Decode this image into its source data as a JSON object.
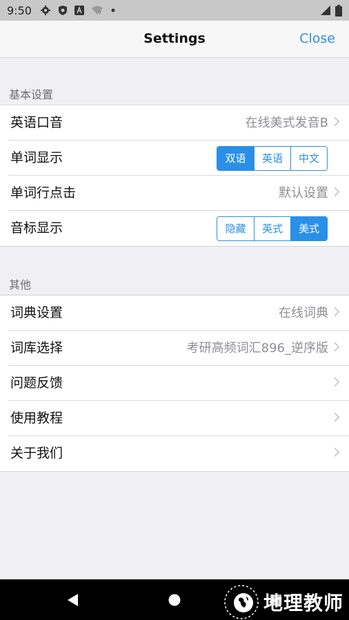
{
  "status_bar": {
    "time": "9:50",
    "icons": [
      "gear-icon",
      "shield-icon",
      "a-icon",
      "wifi-icon",
      "dot-icon"
    ],
    "right_icons": [
      "signal-icon",
      "battery-icon"
    ]
  },
  "nav": {
    "title": "Settings",
    "close_label": "Close"
  },
  "sections": [
    {
      "header": "基本设置",
      "rows": [
        {
          "label": "英语口音",
          "value": "在线美式发音B",
          "type": "disclosure"
        },
        {
          "label": "单词显示",
          "type": "segment",
          "options": [
            "双语",
            "英语",
            "中文"
          ],
          "selected": 0
        },
        {
          "label": "单词行点击",
          "value": "默认设置",
          "type": "disclosure"
        },
        {
          "label": "音标显示",
          "type": "segment",
          "options": [
            "隐藏",
            "英式",
            "美式"
          ],
          "selected": 2
        }
      ]
    },
    {
      "header": "其他",
      "rows": [
        {
          "label": "词典设置",
          "value": "在线词典",
          "type": "disclosure"
        },
        {
          "label": "词库选择",
          "value": "考研高频词汇896_逆序版",
          "type": "disclosure"
        },
        {
          "label": "问题反馈",
          "value": "",
          "type": "disclosure"
        },
        {
          "label": "使用教程",
          "value": "",
          "type": "disclosure"
        },
        {
          "label": "关于我们",
          "value": "",
          "type": "disclosure"
        }
      ]
    }
  ],
  "android_nav": [
    "back-icon",
    "home-icon",
    "recents-icon"
  ],
  "watermark": {
    "text": "地理教师"
  },
  "colors": {
    "accent": "#2a8fe8",
    "background": "#efeff4",
    "secondary_text": "#8e8e93"
  }
}
